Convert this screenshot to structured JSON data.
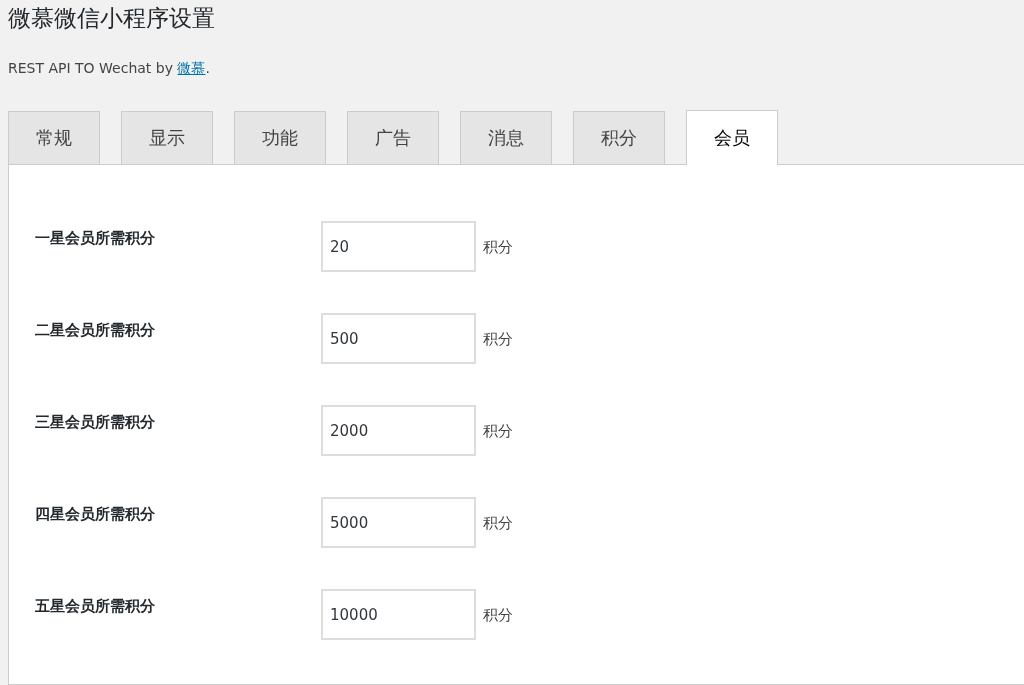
{
  "title": "微慕微信小程序设置",
  "subtitle": {
    "text": "REST API TO Wechat by ",
    "link": "微慕",
    "suffix": "."
  },
  "tabs": [
    {
      "label": "常规",
      "selected": false
    },
    {
      "label": "显示",
      "selected": false
    },
    {
      "label": "功能",
      "selected": false
    },
    {
      "label": "广告",
      "selected": false
    },
    {
      "label": "消息",
      "selected": false
    },
    {
      "label": "积分",
      "selected": false
    },
    {
      "label": "会员",
      "selected": true
    }
  ],
  "fields": [
    {
      "label": "一星会员所需积分",
      "value": "20",
      "unit": "积分"
    },
    {
      "label": "二星会员所需积分",
      "value": "500",
      "unit": "积分"
    },
    {
      "label": "三星会员所需积分",
      "value": "2000",
      "unit": "积分"
    },
    {
      "label": "四星会员所需积分",
      "value": "5000",
      "unit": "积分"
    },
    {
      "label": "五星会员所需积分",
      "value": "10000",
      "unit": "积分"
    }
  ]
}
